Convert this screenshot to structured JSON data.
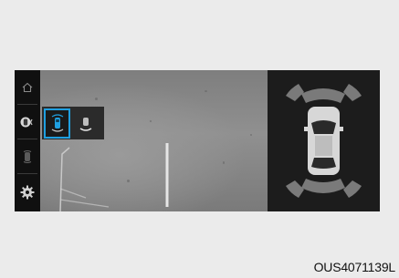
{
  "caption": "OUS4071139L",
  "sidebar": {
    "items": [
      {
        "icon": "home-icon"
      },
      {
        "icon": "camera-view-icon"
      },
      {
        "icon": "parking-sensor-icon"
      },
      {
        "icon": "gear-icon"
      }
    ]
  },
  "view_select": {
    "options": [
      {
        "icon": "top-view-icon",
        "selected": true
      },
      {
        "icon": "rear-view-icon",
        "selected": false
      }
    ]
  },
  "colors": {
    "accent": "#1f9fe0",
    "sensor": "#7a7a7a"
  }
}
